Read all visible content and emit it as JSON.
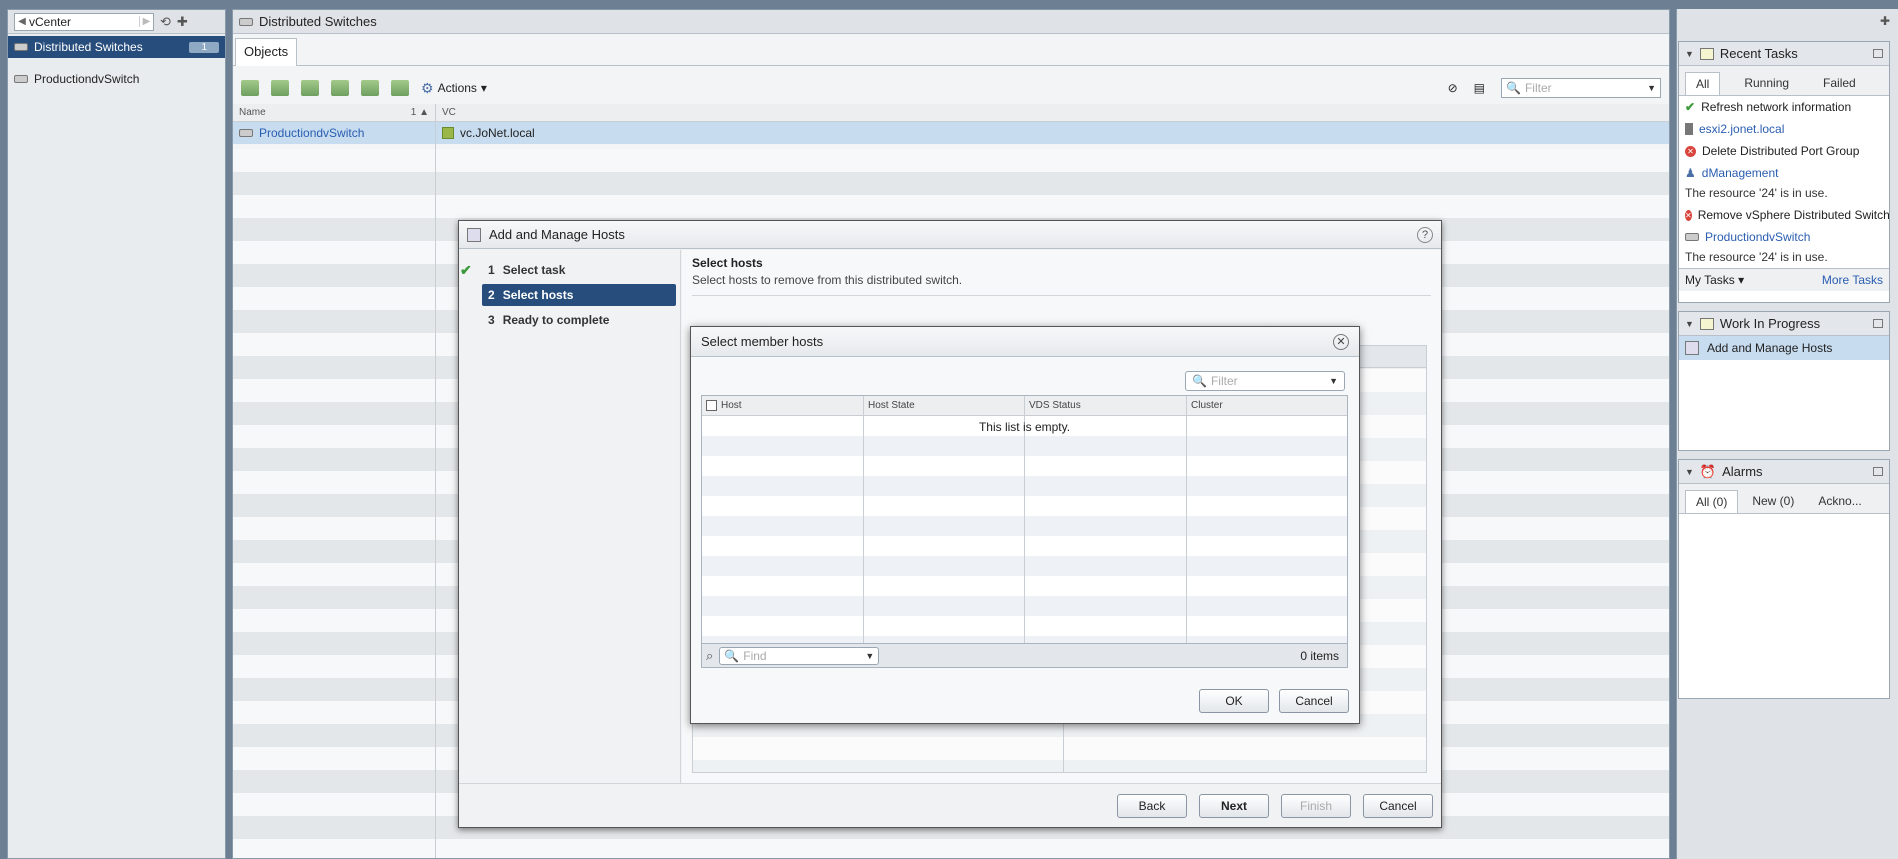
{
  "navigator": {
    "back_label": "vCenter",
    "selected_label": "Distributed Switches",
    "selected_count": "1",
    "items": [
      {
        "label": "ProductiondvSwitch"
      }
    ]
  },
  "main": {
    "title": "Distributed Switches",
    "tab": "Objects",
    "actions_label": "Actions",
    "filter_placeholder": "Filter",
    "columns": {
      "name": "Name",
      "sort": "1 ▲",
      "vc": "VC"
    },
    "row": {
      "name": "ProductiondvSwitch",
      "vc": "vc.JoNet.local"
    }
  },
  "right_panel": {
    "recent_tasks": {
      "title": "Recent Tasks",
      "tabs": [
        "All",
        "Running",
        "Failed"
      ],
      "items": [
        {
          "status": "ok",
          "text": "Refresh network information"
        },
        {
          "status": "host",
          "text": "esxi2.jonet.local"
        },
        {
          "status": "err",
          "text": "Delete Distributed Port Group"
        },
        {
          "status": "portgroup",
          "text": "dManagement"
        },
        {
          "status": "note",
          "text": "The resource '24' is in use."
        },
        {
          "status": "err",
          "text": "Remove vSphere Distributed Switch"
        },
        {
          "status": "switch",
          "text": "ProductiondvSwitch"
        },
        {
          "status": "note",
          "text": "The resource '24' is in use."
        }
      ],
      "my_tasks": "My Tasks",
      "more_tasks": "More Tasks"
    },
    "wip": {
      "title": "Work In Progress",
      "item": "Add and Manage Hosts"
    },
    "alarms": {
      "title": "Alarms",
      "tabs": [
        "All (0)",
        "New (0)",
        "Ackno..."
      ]
    }
  },
  "wizard": {
    "title": "Add and Manage Hosts",
    "help": "?",
    "steps": [
      {
        "num": "1",
        "label": "Select task"
      },
      {
        "num": "2",
        "label": "Select hosts"
      },
      {
        "num": "3",
        "label": "Ready to complete"
      }
    ],
    "content_title": "Select hosts",
    "content_subtitle": "Select hosts to remove from this distributed switch.",
    "buttons": {
      "back": "Back",
      "next": "Next",
      "finish": "Finish",
      "cancel": "Cancel"
    }
  },
  "member_dialog": {
    "title": "Select member hosts",
    "filter_placeholder": "Filter",
    "columns": [
      "Host",
      "Host State",
      "VDS Status",
      "Cluster"
    ],
    "empty_text": "This list is empty.",
    "find_placeholder": "Find",
    "item_count": "0 items",
    "ok": "OK",
    "cancel": "Cancel"
  }
}
